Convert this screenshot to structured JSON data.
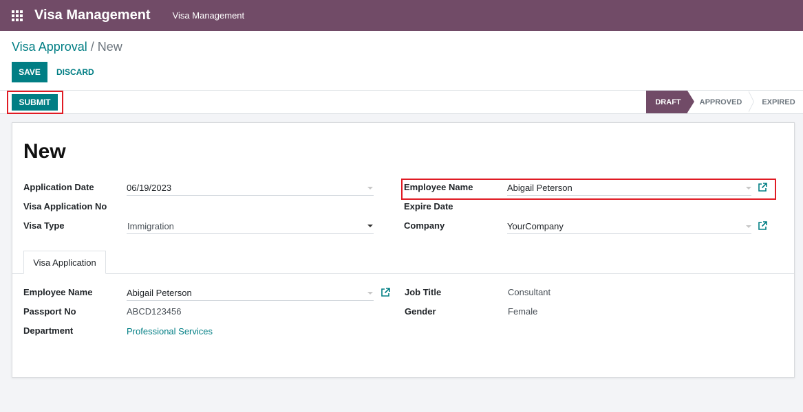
{
  "navbar": {
    "brand": "Visa Management",
    "menu": [
      "Visa Management"
    ]
  },
  "breadcrumb": {
    "parent": "Visa Approval",
    "separator": "/",
    "current": "New"
  },
  "buttons": {
    "save": "SAVE",
    "discard": "DISCARD",
    "submit": "SUBMIT"
  },
  "statusbar": {
    "stages": [
      "DRAFT",
      "APPROVED",
      "EXPIRED"
    ],
    "active": "DRAFT"
  },
  "form": {
    "title": "New",
    "left": {
      "application_date": {
        "label": "Application Date",
        "value": "06/19/2023"
      },
      "visa_application_no": {
        "label": "Visa Application No",
        "value": ""
      },
      "visa_type": {
        "label": "Visa Type",
        "value": "Immigration"
      }
    },
    "right": {
      "employee_name": {
        "label": "Employee Name",
        "value": "Abigail Peterson"
      },
      "expire_date": {
        "label": "Expire Date",
        "value": ""
      },
      "company": {
        "label": "Company",
        "value": "YourCompany"
      }
    },
    "tabs": [
      "Visa Application"
    ],
    "tab_content": {
      "employee_name": {
        "label": "Employee Name",
        "value": "Abigail Peterson"
      },
      "passport_no": {
        "label": "Passport No",
        "value": "ABCD123456"
      },
      "department": {
        "label": "Department",
        "value": "Professional Services"
      },
      "job_title": {
        "label": "Job Title",
        "value": "Consultant"
      },
      "gender": {
        "label": "Gender",
        "value": "Female"
      }
    }
  },
  "colors": {
    "brand": "#714b67",
    "primary": "#017e84",
    "highlight": "#e01b24"
  }
}
